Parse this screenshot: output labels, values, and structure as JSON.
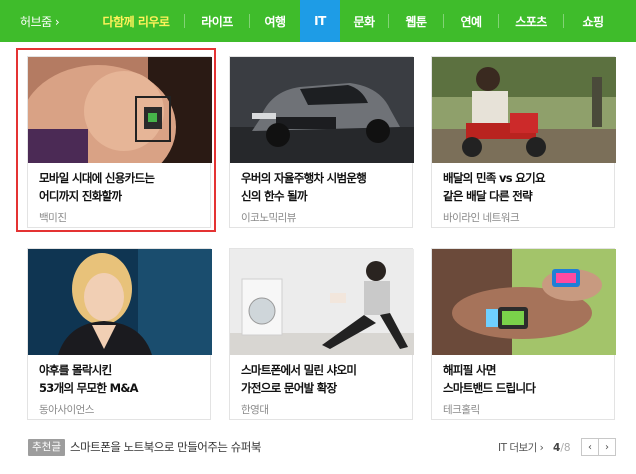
{
  "nav": {
    "title": "허브줌 ›",
    "tabs": [
      {
        "label": "다함께 리우로",
        "state": "featured"
      },
      {
        "label": "라이프",
        "state": "normal"
      },
      {
        "label": "여행",
        "state": "normal"
      },
      {
        "label": "IT",
        "state": "active"
      },
      {
        "label": "문화",
        "state": "normal"
      },
      {
        "label": "웹툰",
        "state": "normal"
      },
      {
        "label": "연예",
        "state": "normal"
      },
      {
        "label": "스포츠",
        "state": "normal"
      },
      {
        "label": "쇼핑",
        "state": "normal"
      }
    ]
  },
  "cards": [
    {
      "title1": "모바일 시대에 신용카드는",
      "title2": "어디까지 진화할까",
      "source": "백미진"
    },
    {
      "title1": "우버의 자율주행차 시범운행",
      "title2": "신의 한수 될까",
      "source": "이코노믹리뷰"
    },
    {
      "title1": "배달의 민족 vs 요기요",
      "title2": "같은 배달 다른 전략",
      "source": "바이라인 네트워크"
    },
    {
      "title1": "야후를 몰락시킨",
      "title2": "53개의 무모한 M&A",
      "source": "동아사이언스"
    },
    {
      "title1": "스마트폰에서 밀린 샤오미",
      "title2": "가전으로 문어발 확장",
      "source": "한영대"
    },
    {
      "title1": "해피필 사면",
      "title2": "스마트밴드 드립니다",
      "source": "테크홀릭"
    }
  ],
  "footer": {
    "badge": "추천글",
    "text": "스마트폰을 노트북으로 만들어주는 슈퍼북",
    "more": "IT 더보기 ›",
    "page_current": "4",
    "page_total": "/8",
    "prev": "‹",
    "next": "›"
  },
  "colors": {
    "nav_bg": "#3fbc2b",
    "active_tab": "#1e9ce6",
    "featured_tab_text": "#fff25a",
    "highlight": "#e43333"
  }
}
